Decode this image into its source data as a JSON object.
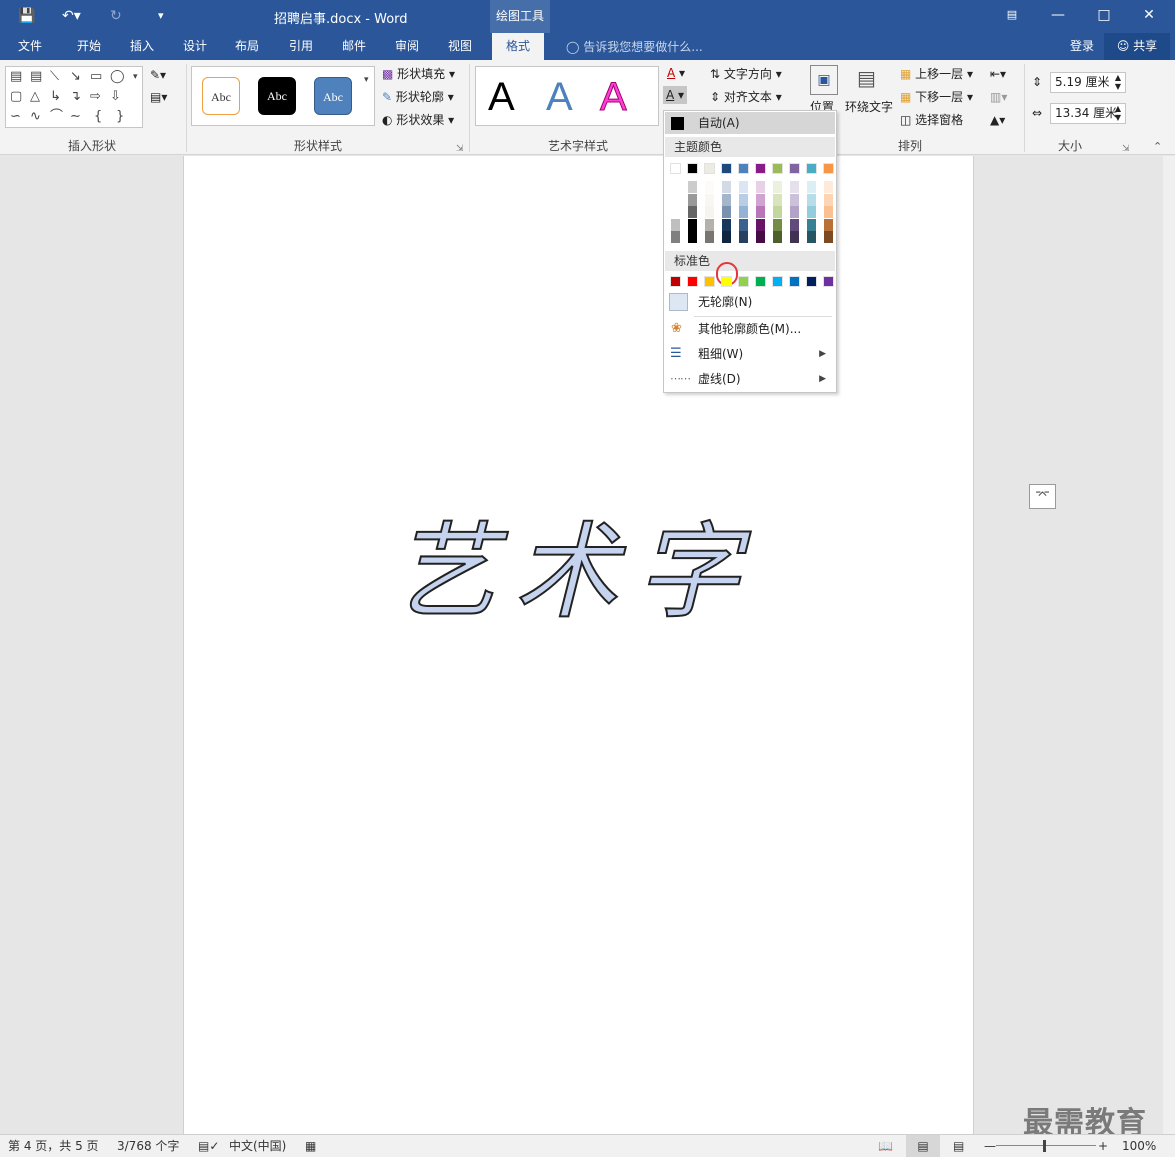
{
  "window": {
    "title": "招聘启事.docx - Word",
    "contextual_tab": "绘图工具"
  },
  "tabs": [
    "文件",
    "开始",
    "插入",
    "设计",
    "布局",
    "引用",
    "邮件",
    "审阅",
    "视图",
    "格式"
  ],
  "active_tab": "格式",
  "tell_me": "告诉我您想要做什么...",
  "login": "登录",
  "share": "共享",
  "ribbon": {
    "insert_shapes_label": "插入形状",
    "shape_styles_label": "形状样式",
    "shape_style_sample": "Abc",
    "shape_fill": "形状填充",
    "shape_outline": "形状轮廓",
    "shape_effects": "形状效果",
    "wordart_styles_label": "艺术字样式",
    "wordart_sample": "A",
    "text_direction": "文字方向",
    "align_text": "对齐文本",
    "position": "位置",
    "wrap_text": "环绕文字",
    "bring_forward": "上移一层",
    "send_backward": "下移一层",
    "selection_pane": "选择窗格",
    "arrange_label": "排列",
    "height_value": "5.19 厘米",
    "width_value": "13.34 厘米",
    "size_label": "大小"
  },
  "menu": {
    "automatic": "自动(A)",
    "theme_colors_label": "主题颜色",
    "standard_colors_label": "标准色",
    "no_outline": "无轮廓(N)",
    "more_colors": "其他轮廓颜色(M)...",
    "weight": "粗细(W)",
    "dashes": "虚线(D)",
    "theme_colors": [
      "#ffffff",
      "#000000",
      "#eeece1",
      "#1f497d",
      "#4f81bd",
      "#8b1a89",
      "#9bbb59",
      "#8064a2",
      "#4bacc6",
      "#f79646"
    ],
    "standard_colors": [
      "#c00000",
      "#ff0000",
      "#ffc000",
      "#ffff00",
      "#92d050",
      "#00b050",
      "#00b0f0",
      "#0070c0",
      "#002060",
      "#7030a0"
    ],
    "highlighted_color": "#ffff00"
  },
  "document": {
    "wordart_text": "艺术字",
    "wordart_fill": "#c5d3ee",
    "wordart_outline": "#222222"
  },
  "status": {
    "page": "第 4 页，共 5 页",
    "words": "3/768 个字",
    "language": "中文(中国)",
    "zoom": "100%"
  },
  "watermark": "最需教育"
}
